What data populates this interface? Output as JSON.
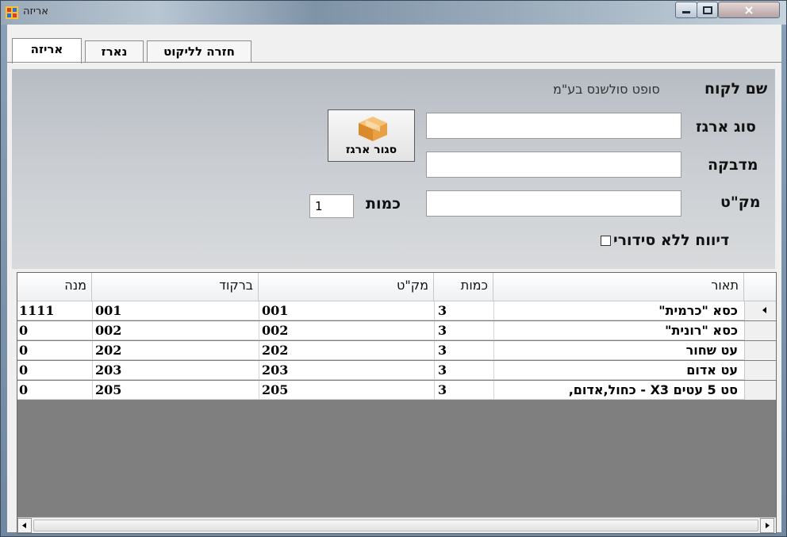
{
  "window": {
    "title": "אריזה",
    "buttons": {
      "minimize": "minimize-icon",
      "maximize": "maximize-icon",
      "close": "close-icon"
    }
  },
  "tabs": [
    {
      "label": "אריזה",
      "selected": true
    },
    {
      "label": "נארז",
      "selected": false
    },
    {
      "label": "חזרה לליקוט",
      "selected": false
    }
  ],
  "form": {
    "customer_label": "שם לקוח",
    "customer_value": "סופט סולשנס בע\"מ",
    "box_type_label": "סוג ארגז",
    "box_type_value": "",
    "sticker_label": "מדבקה",
    "sticker_value": "",
    "sku_label": "מק\"ט",
    "sku_value": "",
    "qty_label": "כמות",
    "qty_value": "1",
    "close_box_label": "סגור ארגז",
    "no_serial_label": "דיווח ללא סידורי",
    "no_serial_checked": false
  },
  "grid": {
    "headers": {
      "desc": "תאור",
      "qty": "כמות",
      "sku": "מק\"ט",
      "barcode": "ברקוד",
      "lot": "מנה"
    },
    "rows": [
      {
        "desc": "כסא \"כרמית\"",
        "qty": "3",
        "sku": "001",
        "barcode": "001",
        "lot": "1111",
        "current": true
      },
      {
        "desc": "כסא \"רונית\"",
        "qty": "3",
        "sku": "002",
        "barcode": "002",
        "lot": "0",
        "current": false
      },
      {
        "desc": "עט שחור",
        "qty": "3",
        "sku": "202",
        "barcode": "202",
        "lot": "0",
        "current": false
      },
      {
        "desc": "עט אדום",
        "qty": "3",
        "sku": "203",
        "barcode": "203",
        "lot": "0",
        "current": false
      },
      {
        "desc": "סט 5 עטים X3 - כחול,אדום,",
        "qty": "3",
        "sku": "205",
        "barcode": "205",
        "lot": "0",
        "current": false
      }
    ]
  },
  "colors": {
    "title_bar": "#9fb0bf",
    "form_bg": "#c9cdd2",
    "grid_bg": "#7f7f7f"
  }
}
